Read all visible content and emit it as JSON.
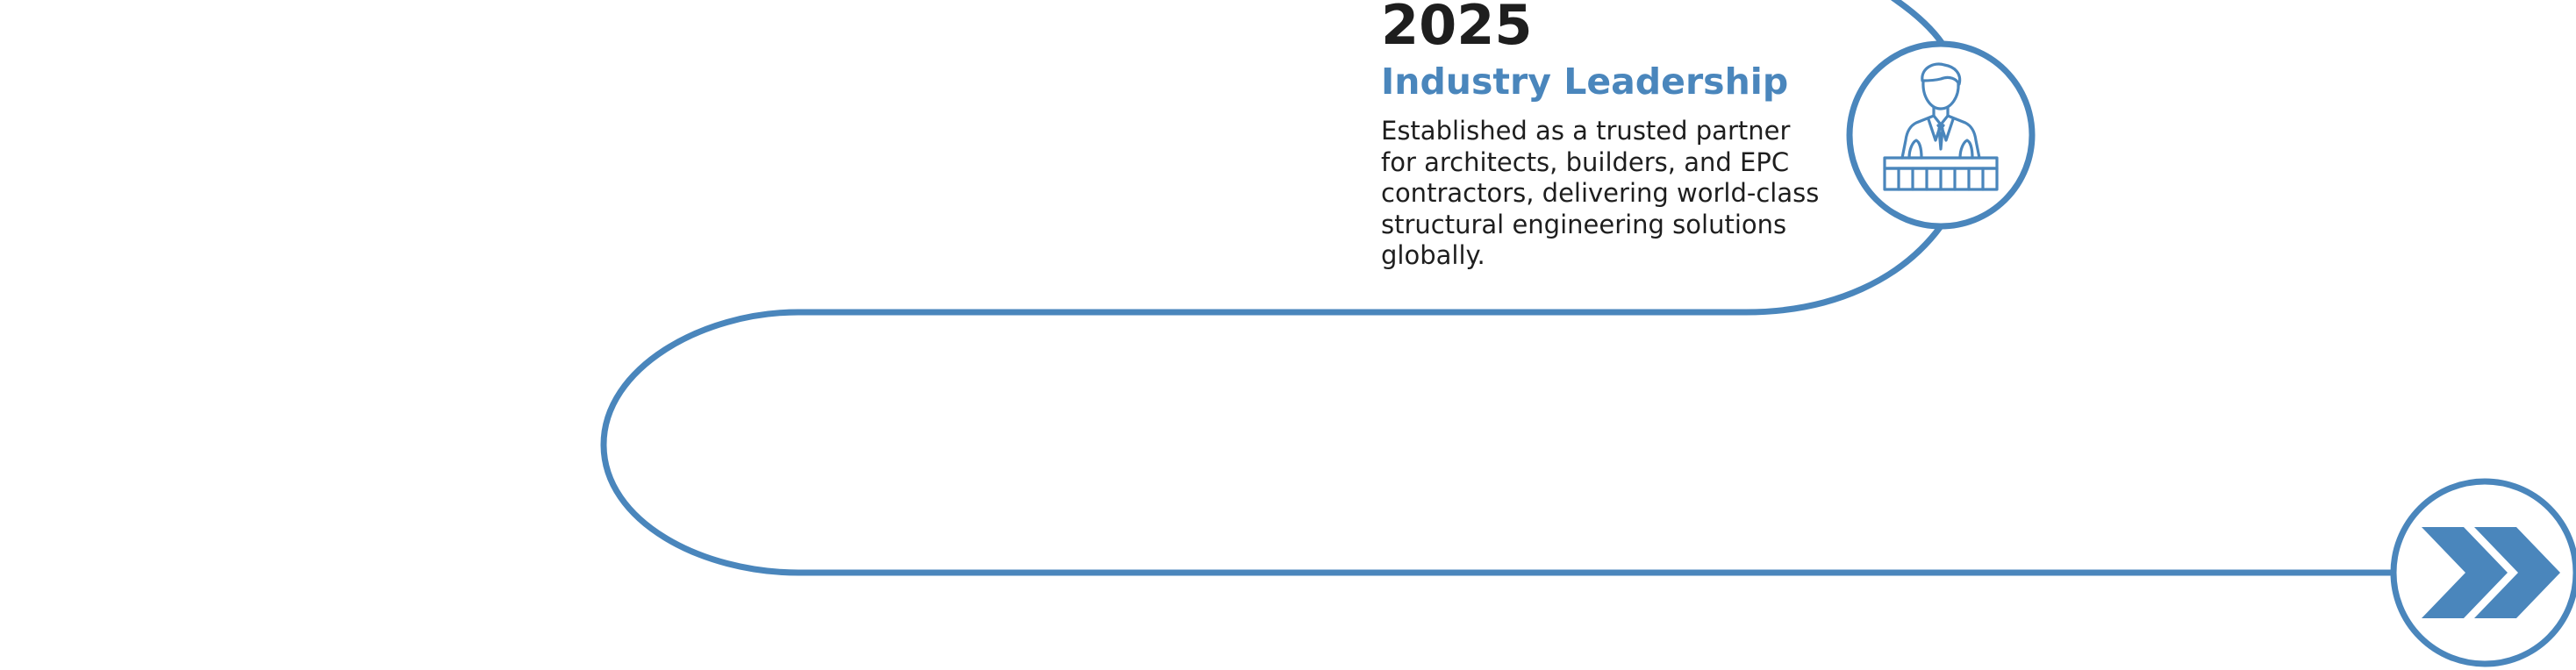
{
  "colors": {
    "accent": "#4A86BC",
    "text": "#1E1E1E",
    "background": "#FFFFFF"
  },
  "milestone": {
    "year": "2025",
    "title": "Industry Leadership",
    "description_lines": [
      "Established as a trusted partner",
      "for architects, builders, and EPC",
      "contractors, delivering world-class",
      "structural engineering solutions",
      "globally."
    ],
    "icon": "businessman-at-podium-icon"
  },
  "end_marker": {
    "icon": "double-chevron-right-icon"
  }
}
